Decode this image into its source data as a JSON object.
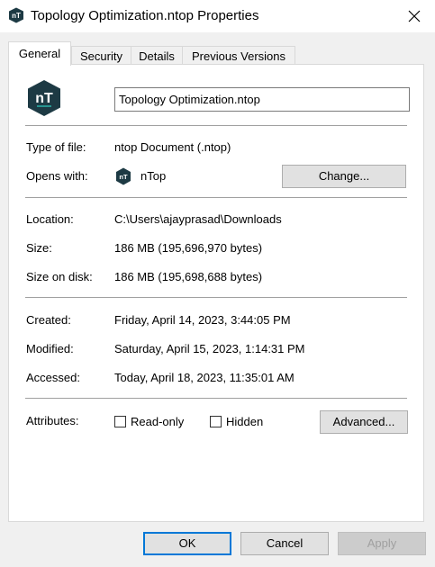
{
  "window": {
    "title": "Topology Optimization.ntop Properties"
  },
  "app_icon": {
    "text": "nT",
    "color": "#1d3a44",
    "accent": "#2bb3a9"
  },
  "tabs": [
    {
      "label": "General",
      "active": true
    },
    {
      "label": "Security",
      "active": false
    },
    {
      "label": "Details",
      "active": false
    },
    {
      "label": "Previous Versions",
      "active": false
    }
  ],
  "general": {
    "file_name": "Topology Optimization.ntop",
    "type_label": "Type of file:",
    "type_value": "ntop Document (.ntop)",
    "opens_label": "Opens with:",
    "opens_value": "nTop",
    "change_button": "Change...",
    "location_label": "Location:",
    "location_value": "C:\\Users\\ajayprasad\\Downloads",
    "size_label": "Size:",
    "size_value": "186 MB (195,696,970 bytes)",
    "size_disk_label": "Size on disk:",
    "size_disk_value": "186 MB (195,698,688 bytes)",
    "created_label": "Created:",
    "created_value": "Friday, April 14, 2023, 3:44:05 PM",
    "modified_label": "Modified:",
    "modified_value": "Saturday, April 15, 2023, 1:14:31 PM",
    "accessed_label": "Accessed:",
    "accessed_value": "Today, April 18, 2023, 11:35:01 AM",
    "attributes_label": "Attributes:",
    "readonly_label": "Read-only",
    "readonly_checked": false,
    "hidden_label": "Hidden",
    "hidden_checked": false,
    "advanced_button": "Advanced..."
  },
  "footer": {
    "ok": "OK",
    "cancel": "Cancel",
    "apply": "Apply"
  },
  "colors": {
    "accent": "#0078d7",
    "window_bg": "#f0f0f0",
    "panel_bg": "#ffffff"
  }
}
